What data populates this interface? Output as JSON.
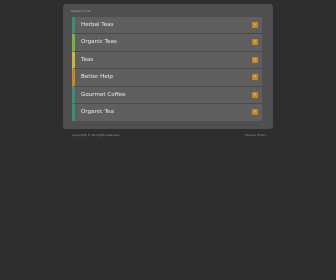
{
  "related": {
    "label": "Related Links"
  },
  "links": [
    {
      "label": "Herbal Teas",
      "accent": "#3a8f7a",
      "arrow_icon": "arrow-right-icon"
    },
    {
      "label": "Organic Teas",
      "accent": "#7fb03a",
      "arrow_icon": "arrow-right-icon"
    },
    {
      "label": "Teas",
      "accent": "#c9b83a",
      "arrow_icon": "arrow-right-icon"
    },
    {
      "label": "Better Help",
      "accent": "#c8891a",
      "arrow_icon": "arrow-right-icon"
    },
    {
      "label": "Gourmet Coffee",
      "accent": "#3a8f7a",
      "arrow_icon": "arrow-right-icon"
    },
    {
      "label": "Organic Tea",
      "accent": "#3a8f7a",
      "arrow_icon": "arrow-right-icon"
    }
  ],
  "footer": {
    "copyright": "Copyright © All rights reserved.",
    "privacy": "Privacy Policy"
  },
  "colors": {
    "background": "#2e2e2e",
    "panel": "#4f4f4f",
    "item": "#5f5f5f",
    "arrow": "#c8891a"
  }
}
